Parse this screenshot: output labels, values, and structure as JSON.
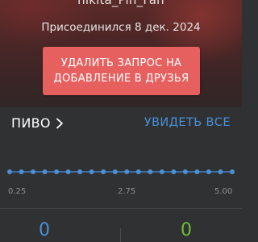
{
  "profile": {
    "username": "nikita_Pin_Fan",
    "joined": "Присоединился 8 дек. 2024",
    "remove_request_label": "УДАЛИТЬ ЗАПРОС НА ДОБАВЛЕНИЕ В ДРУЗЬЯ"
  },
  "beer": {
    "title": "ПИВО",
    "see_all_label": "УВИДЕТЬ ВСЕ",
    "rating_axis": [
      "0.25",
      "2.75",
      "5.00"
    ],
    "rating_points": 20,
    "stats": {
      "left_value": "0",
      "right_value": "0"
    }
  },
  "colors": {
    "accent_blue": "#4a90d9",
    "accent_green": "#6bbf3a",
    "button_red": "#e5605f",
    "background": "#2f3132"
  },
  "icons": {
    "title_chevron": "chevron-right-icon"
  }
}
